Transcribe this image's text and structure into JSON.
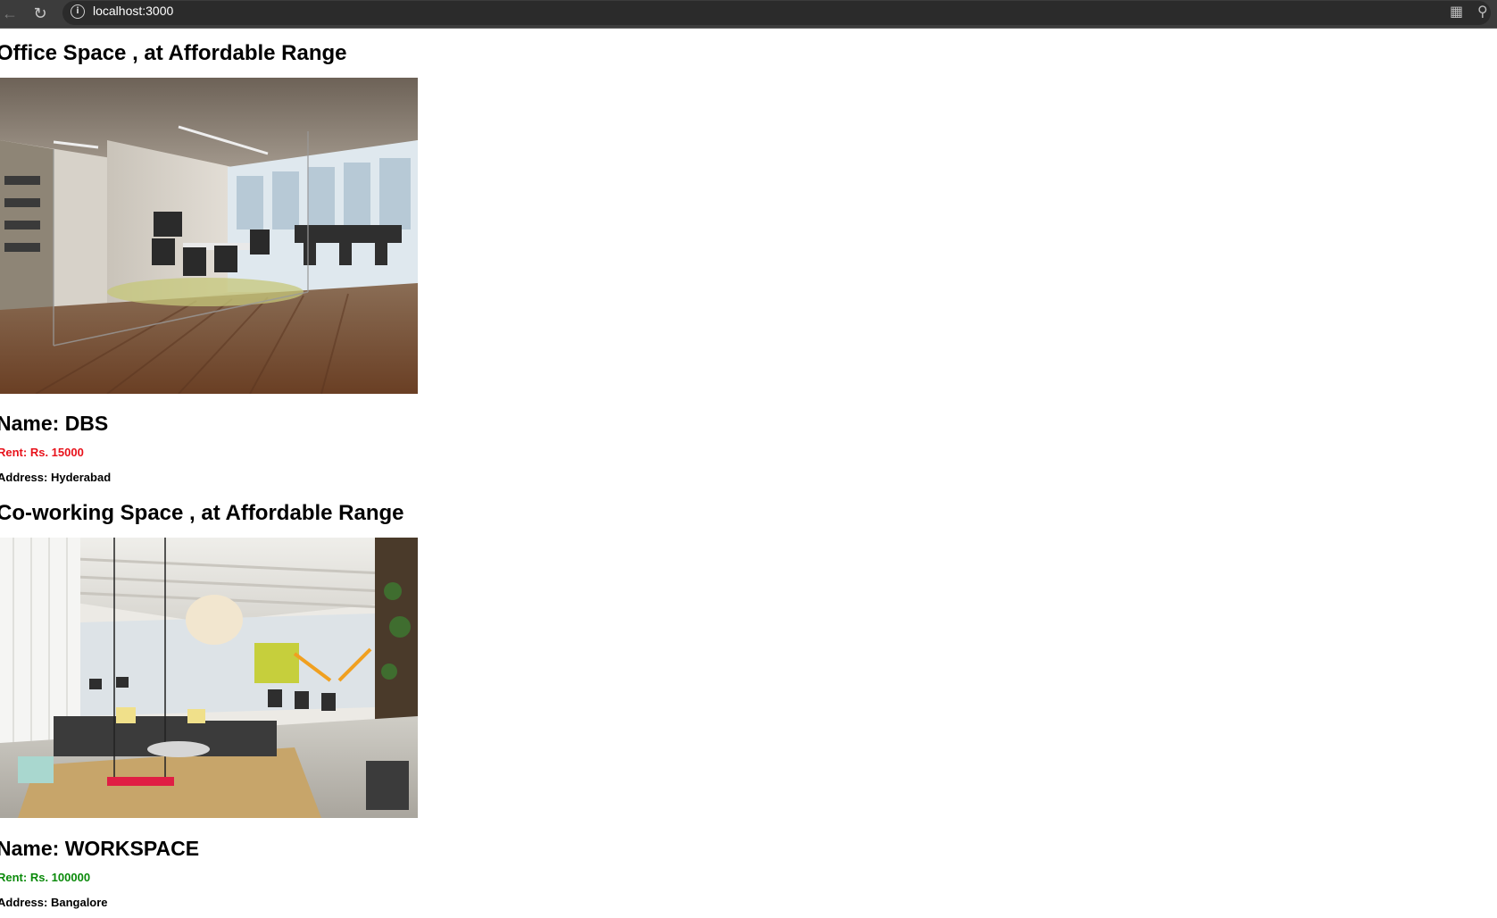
{
  "browser": {
    "url": "localhost:3000",
    "back_icon": "arrow-left-icon",
    "reload_icon": "reload-icon",
    "info_icon": "info-icon",
    "apps_icon": "apps-icon",
    "zoom_icon": "zoom-icon"
  },
  "listings": [
    {
      "heading": "Office Space , at Affordable Range",
      "image_subject": "office-interior-photo",
      "name": "Name: DBS",
      "rent": "Rent: Rs. 15000",
      "rent_color": "#e8121b",
      "address": "Address: Hyderabad"
    },
    {
      "heading": "Co-working Space , at Affordable Range",
      "image_subject": "coworking-interior-photo",
      "name": "Name: WORKSPACE",
      "rent": "Rent: Rs. 100000",
      "rent_color": "#0a8a0a",
      "address": "Address: Bangalore"
    }
  ]
}
